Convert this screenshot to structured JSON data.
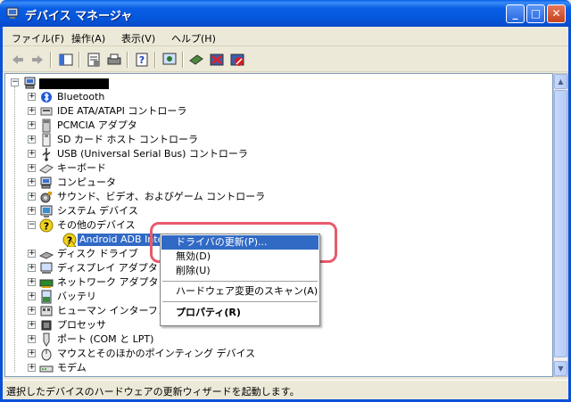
{
  "window": {
    "title": "デバイス マネージャ",
    "minimize": "_",
    "maximize": "□",
    "close": "✕"
  },
  "menu": [
    {
      "label": "ファイル(F)"
    },
    {
      "label": "操作(A)"
    },
    {
      "label": "表示(V)"
    },
    {
      "label": "ヘルプ(H)"
    }
  ],
  "toolbar": {
    "icons": [
      "back-icon",
      "forward-icon",
      "console-tree-icon",
      "properties-icon",
      "print-icon",
      "help-icon",
      "scan-hardware-icon",
      "update-driver-icon",
      "uninstall-icon",
      "disable-icon"
    ]
  },
  "tree": {
    "root": "",
    "items": [
      {
        "label": "Bluetooth",
        "icon": "bluetooth-icon"
      },
      {
        "label": "IDE ATA/ATAPI コントローラ",
        "icon": "ide-controller-icon"
      },
      {
        "label": "PCMCIA アダプタ",
        "icon": "pcmcia-icon"
      },
      {
        "label": "SD カード ホスト コントローラ",
        "icon": "sd-card-icon"
      },
      {
        "label": "USB (Universal Serial Bus) コントローラ",
        "icon": "usb-icon"
      },
      {
        "label": "キーボード",
        "icon": "keyboard-icon"
      },
      {
        "label": "コンピュータ",
        "icon": "computer-icon"
      },
      {
        "label": "サウンド、ビデオ、およびゲーム コントローラ",
        "icon": "sound-icon"
      },
      {
        "label": "システム デバイス",
        "icon": "system-icon"
      },
      {
        "label": "その他のデバイス",
        "icon": "unknown-device-icon"
      },
      {
        "label": "Android ADB Inter",
        "icon": "warning-device-icon"
      },
      {
        "label": "ディスク ドライブ",
        "icon": "disk-drive-icon"
      },
      {
        "label": "ディスプレイ アダプタ",
        "icon": "display-adapter-icon"
      },
      {
        "label": "ネットワーク アダプタ",
        "icon": "network-adapter-icon"
      },
      {
        "label": "バッテリ",
        "icon": "battery-icon"
      },
      {
        "label": "ヒューマン インターフェイス",
        "icon": "hid-icon"
      },
      {
        "label": "プロセッサ",
        "icon": "processor-icon"
      },
      {
        "label": "ポート (COM と LPT)",
        "icon": "port-icon"
      },
      {
        "label": "マウスとそのほかのポインティング デバイス",
        "icon": "mouse-icon"
      },
      {
        "label": "モデム",
        "icon": "modem-icon"
      }
    ]
  },
  "context_menu": {
    "update_driver": "ドライバの更新(P)...",
    "disable": "無効(D)",
    "uninstall": "削除(U)",
    "scan": "ハードウェア変更のスキャン(A)",
    "properties": "プロパティ(R)"
  },
  "status": {
    "text": "選択したデバイスのハードウェアの更新ウィザードを起動します。"
  },
  "colors": {
    "titlebar": "#0556dc",
    "selection": "#316ac5",
    "annotation": "#e85a6b"
  }
}
